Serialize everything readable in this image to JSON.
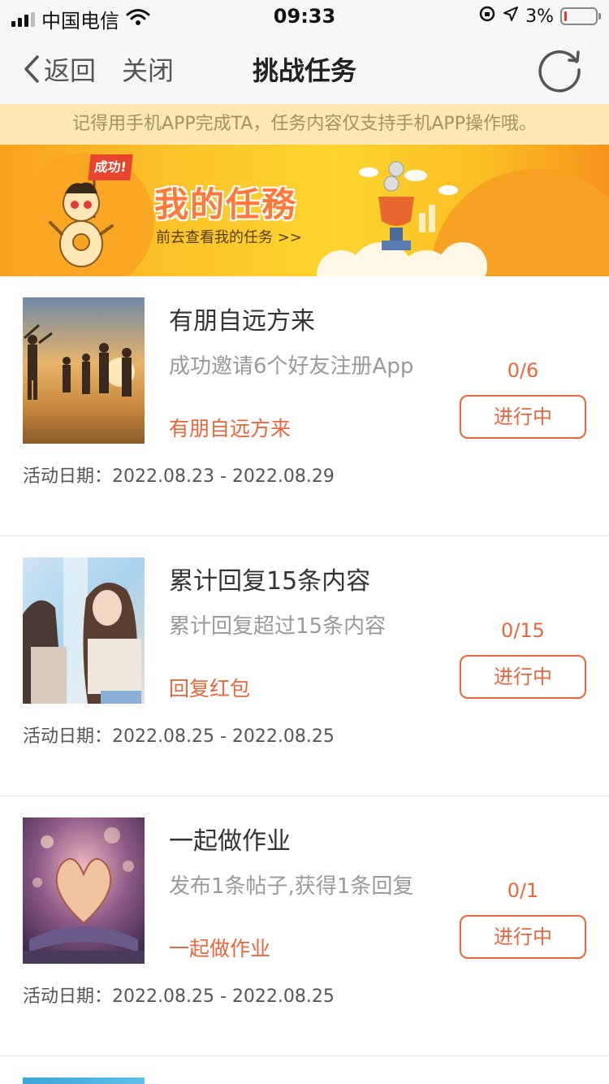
{
  "status_bar": {
    "carrier": "中国电信",
    "time": "09:33",
    "battery": "3%"
  },
  "nav": {
    "back_label": "返回",
    "close_label": "关闭",
    "title": "挑战任务"
  },
  "notice": "记得用手机APP完成TA，任务内容仅支持手机APP操作哦。",
  "banner": {
    "flag": "成功!",
    "title": "我的任務",
    "link": "前去查看我的任务 >>"
  },
  "date_prefix": "活动日期：",
  "tasks": [
    {
      "name": "有朋自远方来",
      "desc": "成功邀请6个好友注册App",
      "tag": "有朋自远方来",
      "progress": "0/6",
      "status": "进行中",
      "date": "2022.08.23 - 2022.08.29"
    },
    {
      "name": "累计回复15条内容",
      "desc": "累计回复超过15条内容",
      "tag": "回复红包",
      "progress": "0/15",
      "status": "进行中",
      "date": "2022.08.25 - 2022.08.25"
    },
    {
      "name": "一起做作业",
      "desc": "发布1条帖子,获得1条回复",
      "tag": "一起做作业",
      "progress": "0/1",
      "status": "进行中",
      "date": "2022.08.25 - 2022.08.25"
    }
  ]
}
